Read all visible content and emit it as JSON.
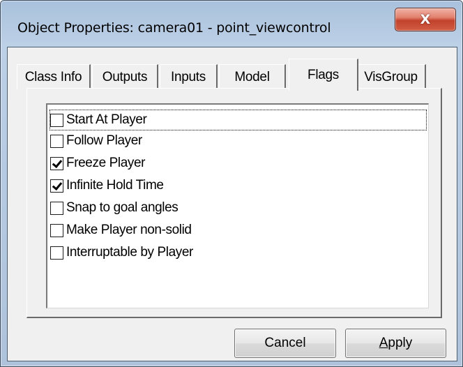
{
  "window": {
    "title": "Object Properties: camera01 - point_viewcontrol",
    "close_label": "X"
  },
  "tabs": [
    {
      "label": "Class Info",
      "active": false
    },
    {
      "label": "Outputs",
      "active": false
    },
    {
      "label": "Inputs",
      "active": false
    },
    {
      "label": "Model",
      "active": false
    },
    {
      "label": "Flags",
      "active": true
    },
    {
      "label": "VisGroup",
      "active": false
    }
  ],
  "flags": [
    {
      "label": "Start At Player",
      "checked": false,
      "focused": true
    },
    {
      "label": "Follow Player",
      "checked": false,
      "focused": false
    },
    {
      "label": "Freeze Player",
      "checked": true,
      "focused": false
    },
    {
      "label": "Infinite Hold Time",
      "checked": true,
      "focused": false
    },
    {
      "label": "Snap to goal angles",
      "checked": false,
      "focused": false
    },
    {
      "label": "Make Player non-solid",
      "checked": false,
      "focused": false
    },
    {
      "label": "Interruptable by Player",
      "checked": false,
      "focused": false
    }
  ],
  "buttons": {
    "cancel_label": "Cancel",
    "apply_mnemonic": "A",
    "apply_rest": "pply"
  }
}
